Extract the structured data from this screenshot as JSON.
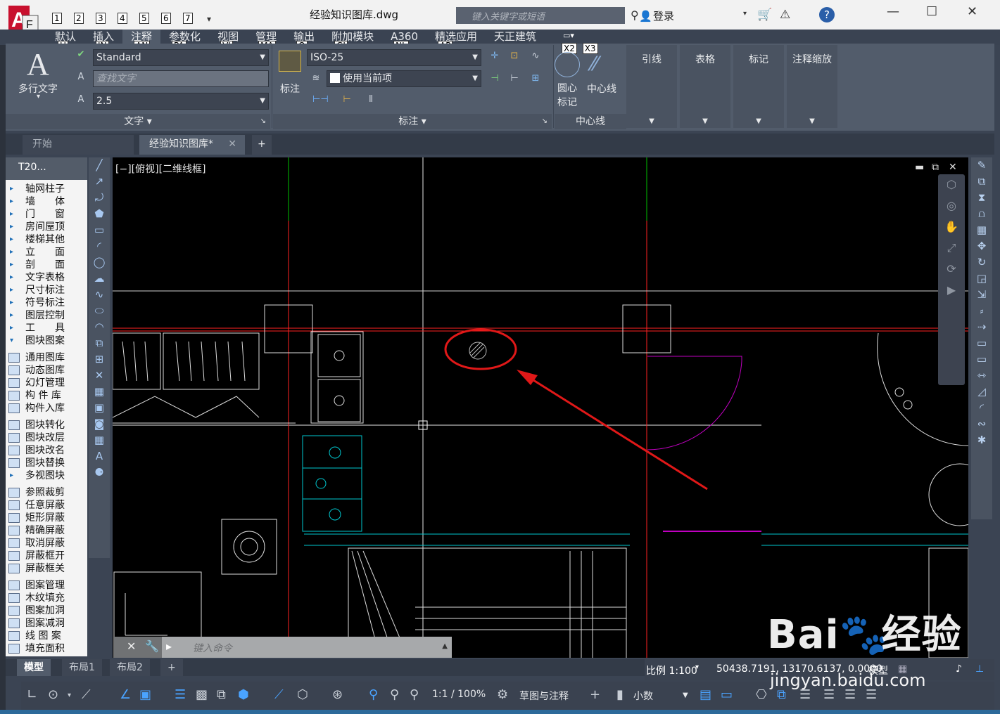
{
  "window": {
    "title": "经验知识图库.dwg",
    "search_placeholder": "键入关键字或短语",
    "login": "登录",
    "qat_keys": [
      "1",
      "2",
      "3",
      "4",
      "5",
      "6",
      "7"
    ]
  },
  "ribbon": {
    "tabs": [
      {
        "label": "默认",
        "key": "H"
      },
      {
        "label": "插入",
        "key": "IN"
      },
      {
        "label": "注释",
        "key": "AN"
      },
      {
        "label": "参数化",
        "key": "PA"
      },
      {
        "label": "视图",
        "key": "VI"
      },
      {
        "label": "管理",
        "key": "MA"
      },
      {
        "label": "输出",
        "key": "O"
      },
      {
        "label": "附加模块",
        "key": "GI"
      },
      {
        "label": "A360",
        "key": "NL"
      },
      {
        "label": "精选应用",
        "key": "AP"
      },
      {
        "label": "天正建筑",
        "key": ""
      }
    ],
    "extra_keys": [
      "X2",
      "X3"
    ],
    "text_panel": {
      "big_label": "多行文字",
      "style": "Standard",
      "find_placeholder": "查找文字",
      "height": "2.5",
      "footer": "文字"
    },
    "dim_panel": {
      "label": "标注",
      "style": "ISO-25",
      "layer": "使用当前项",
      "footer": "标注"
    },
    "center_panel": {
      "center_mark": "圆心\n标记",
      "center_mark_1": "圆心",
      "center_mark_2": "标记",
      "center_line": "中心线",
      "footer": "中心线"
    },
    "side_panels": [
      "引线",
      "表格",
      "标记",
      "注释缩放"
    ]
  },
  "file_tabs": {
    "start": "开始",
    "doc": "经验知识图库*",
    "plus": "+"
  },
  "t20": {
    "title": "T20...",
    "groups": [
      [
        "轴网柱子",
        "墙　　体",
        "门　　窗",
        "房间屋顶",
        "楼梯其他",
        "立　　面",
        "剖　　面",
        "文字表格",
        "尺寸标注",
        "符号标注",
        "图层控制",
        "工　　具",
        "图块图案"
      ],
      [
        "通用图库",
        "动态图库",
        "幻灯管理",
        "构 件 库",
        "构件入库"
      ],
      [
        "图块转化",
        "图块改层",
        "图块改名",
        "图块替换",
        "多视图块"
      ],
      [
        "参照裁剪",
        "任意屏蔽",
        "矩形屏蔽",
        "精确屏蔽",
        "取消屏蔽",
        "屏蔽框开",
        "屏蔽框关"
      ],
      [
        "图案管理",
        "木纹填充",
        "图案加洞",
        "图案减洞",
        "线 图 案",
        "填充面积"
      ]
    ]
  },
  "viewport": {
    "label": "[−][俯视][二维线框]",
    "command_placeholder": "键入命令"
  },
  "layout_tabs": [
    "模型",
    "布局1",
    "布局2"
  ],
  "status": {
    "scale": "比例 1:100",
    "coords": "50438.7191, 13170.6137, 0.0000",
    "model": "模型",
    "annot_scale": "1:1 / 100%",
    "workspace": "草图与注释",
    "units": "小数"
  },
  "watermark": {
    "text": "Bai",
    "text2": "经验",
    "url": "jingyan.baidu.com"
  },
  "colors": {
    "accent_annotation": "#ff2222",
    "cyan_lines": "#00c8d0",
    "magenta_door": "#c000c0"
  }
}
